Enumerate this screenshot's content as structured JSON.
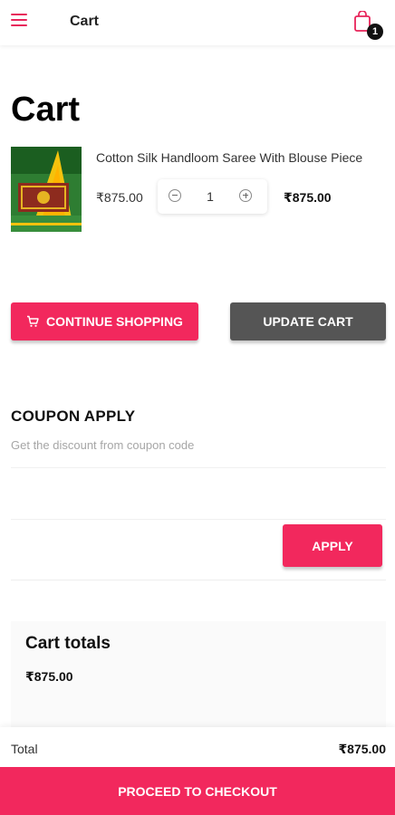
{
  "header": {
    "title": "Cart",
    "cart_count": "1"
  },
  "page": {
    "title": "Cart"
  },
  "cart_item": {
    "name": "Cotton Silk Handloom Saree With Blouse Piece",
    "unit_price": "₹875.00",
    "quantity": "1",
    "line_total": "₹875.00"
  },
  "actions": {
    "continue_shopping": "CONTINUE SHOPPING",
    "update_cart": "UPDATE CART"
  },
  "coupon": {
    "heading": "COUPON APPLY",
    "subtext": "Get the discount from coupon code",
    "input_value": "",
    "apply_label": "APPLY"
  },
  "totals": {
    "title": "Cart totals",
    "subtotal": "₹875.00",
    "total_label": "Total",
    "total_value": "₹875.00"
  },
  "checkout": {
    "label": "PROCEED TO CHECKOUT"
  },
  "colors": {
    "accent": "#f2285d",
    "dark_button": "#555555"
  }
}
